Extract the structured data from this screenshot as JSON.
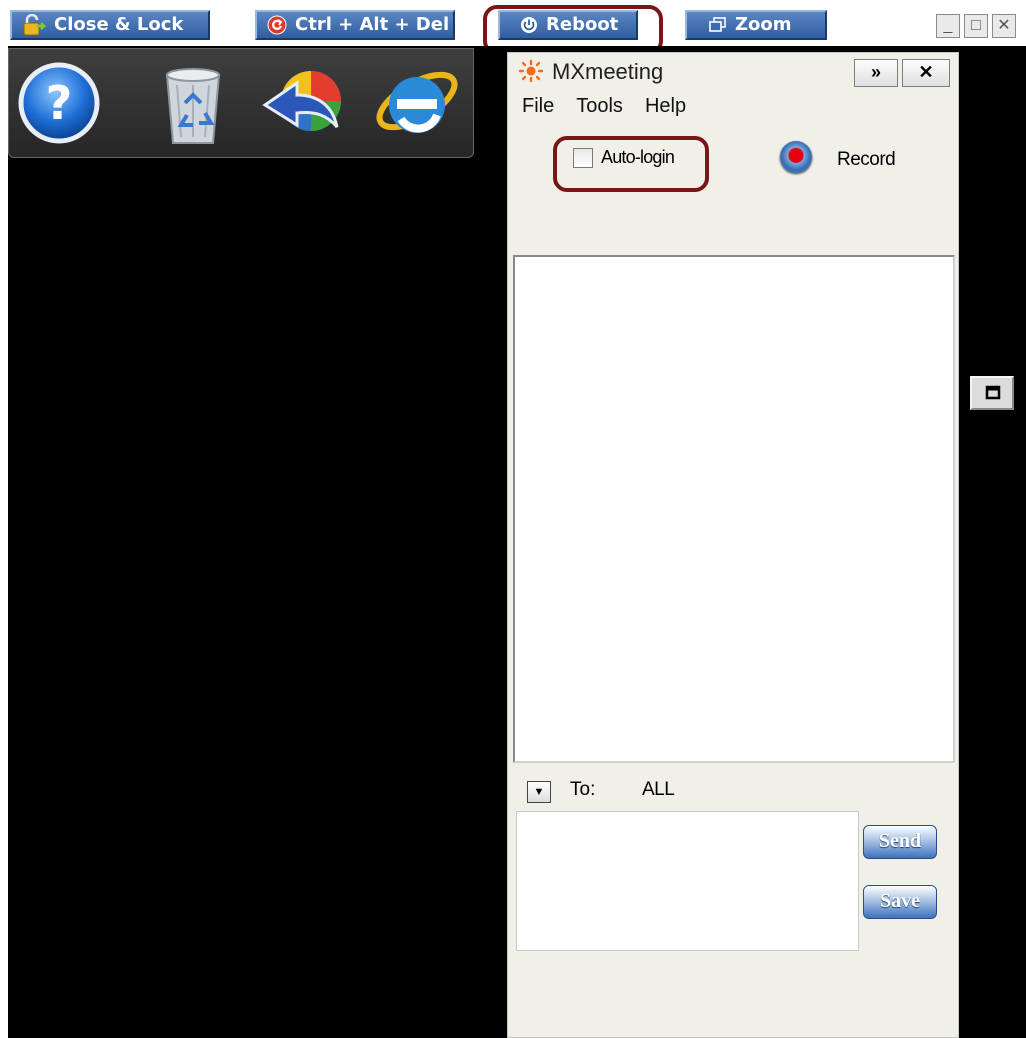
{
  "toolbar": {
    "close_lock_label": "Close & Lock",
    "ctrl_alt_del_label": "Ctrl + Alt + Del",
    "reboot_label": "Reboot",
    "zoom_label": "Zoom",
    "minimize": "_",
    "restore": "□",
    "close": "✕"
  },
  "dock": {
    "icons": [
      "help-icon",
      "recycle-bin-icon",
      "back-globe-icon",
      "internet-explorer-icon"
    ],
    "help_glyph": "?"
  },
  "panel": {
    "title": "MXmeeting",
    "collapse_label": "»",
    "close_label": "✕",
    "menu": {
      "file": "File",
      "tools": "Tools",
      "help": "Help"
    },
    "auto_login_label": "Auto-login",
    "auto_login_checked": false,
    "record_label": "Record",
    "to_label": "To:",
    "to_value": "ALL",
    "message_value": "",
    "send_label": "Send",
    "save_label": "Save"
  },
  "colors": {
    "toolbar_button": "#2f5e9f",
    "highlight_outline": "#7a1616",
    "record_dot": "#e4000f",
    "remote_background": "#000000",
    "panel_background": "#f1f0e8"
  }
}
